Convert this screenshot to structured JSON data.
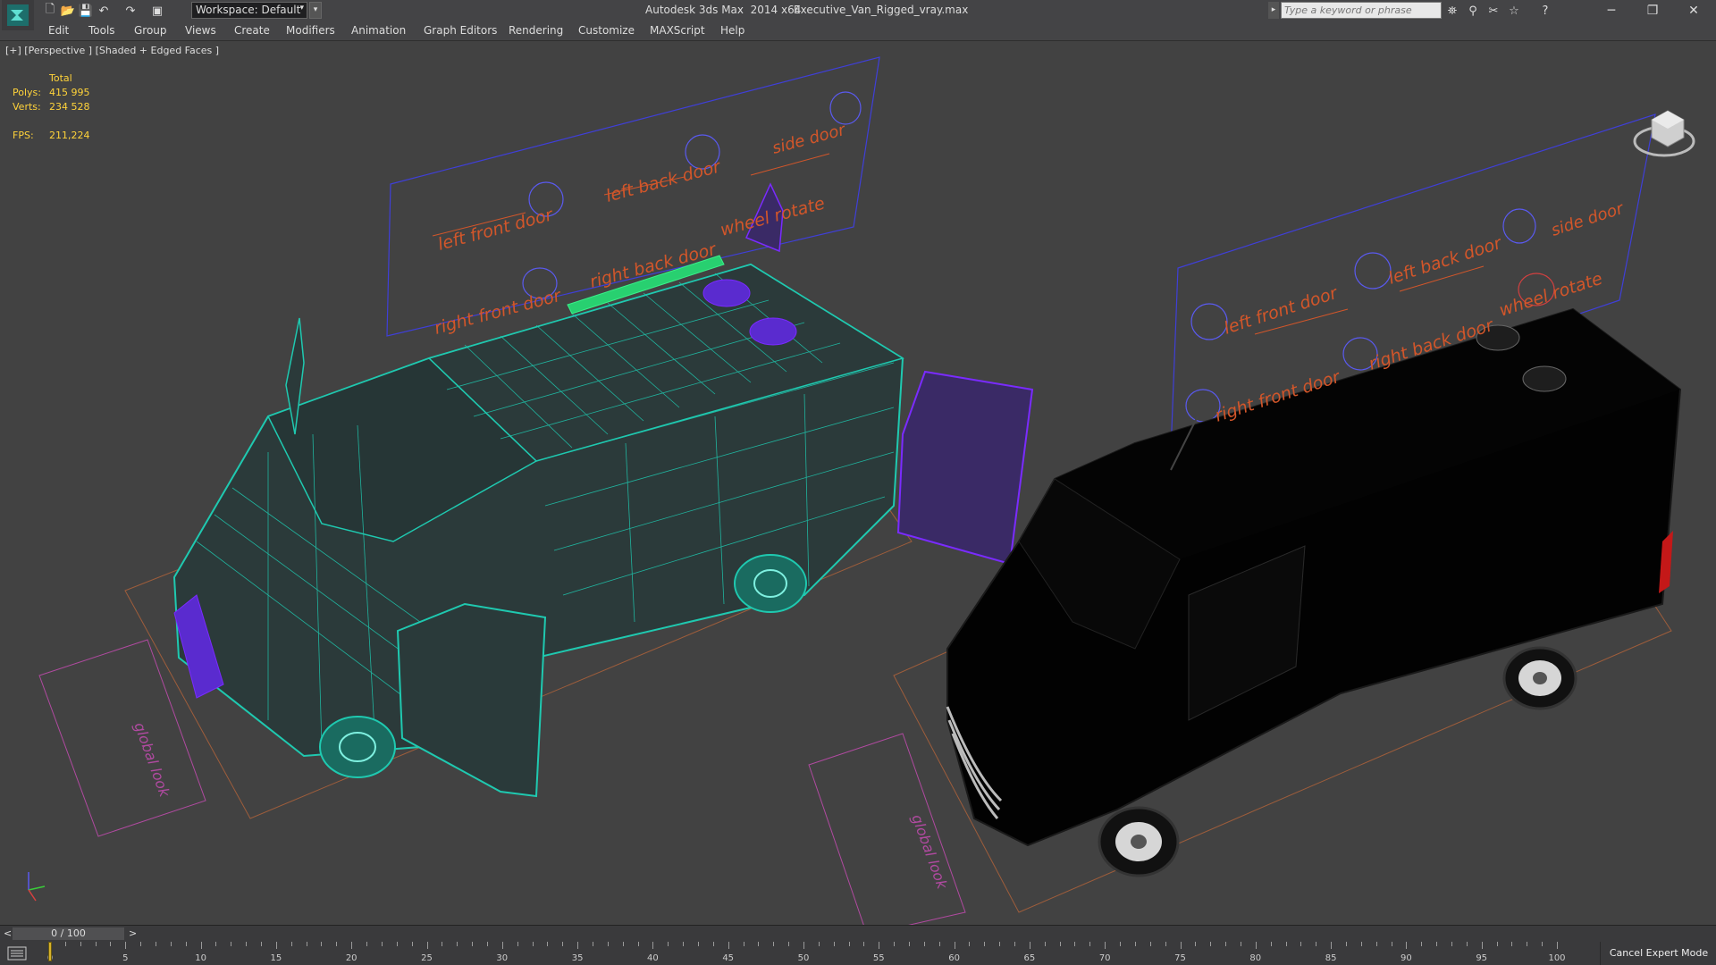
{
  "app": {
    "title": "Autodesk 3ds Max  2014 x64",
    "file": "Executive_Van_Rigged_vray.max"
  },
  "toolbar": {
    "workspace": "Workspace: Default",
    "search_placeholder": "Type a keyword or phrase"
  },
  "window_controls": {
    "minimize": "─",
    "maximize": "❐",
    "close": "✕"
  },
  "menu": [
    "Edit",
    "Tools",
    "Group",
    "Views",
    "Create",
    "Modifiers",
    "Animation",
    "Graph Editors",
    "Rendering",
    "Customize",
    "MAXScript",
    "Help"
  ],
  "viewport": {
    "label": "[+] [Perspective ] [Shaded + Edged Faces ]",
    "stats": {
      "total_label": "Total",
      "polys_label": "Polys:",
      "polys": "415 995",
      "verts_label": "Verts:",
      "verts": "234 528",
      "fps_label": "FPS:",
      "fps": "211,224"
    },
    "panel_left": {
      "labels": [
        "left front door",
        "left back door",
        "side door",
        "right front door",
        "right back door",
        "wheel rotate"
      ]
    },
    "panel_right": {
      "labels": [
        "left front door",
        "left back door",
        "side door",
        "right front door",
        "right back door",
        "wheel rotate"
      ]
    },
    "ground_label": "global look"
  },
  "time_slider": {
    "position": "0 / 100",
    "prev": "<",
    "next": ">"
  },
  "track_bar": {
    "ticks": [
      "0",
      "5",
      "10",
      "15",
      "20",
      "25",
      "30",
      "35",
      "40",
      "45",
      "50",
      "55",
      "60",
      "65",
      "70",
      "75",
      "80",
      "85",
      "90",
      "95",
      "100"
    ]
  },
  "status": {
    "expert_mode": "Cancel Expert Mode"
  },
  "colors": {
    "wire": "#1fc9b0",
    "selected": "#7a2bff",
    "control_label": "#d2562a",
    "stats": "#ffd33a",
    "viewport_bg": "#424242"
  }
}
